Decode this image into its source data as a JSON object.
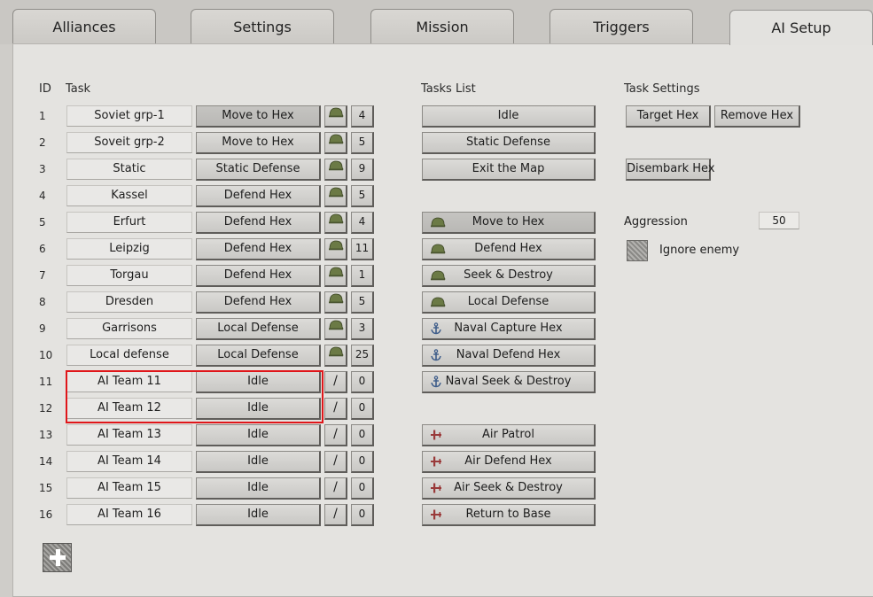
{
  "tabs": [
    {
      "label": "Alliances"
    },
    {
      "label": "Settings"
    },
    {
      "label": "Mission"
    },
    {
      "label": "Triggers"
    },
    {
      "label": "AI Setup",
      "active": true
    }
  ],
  "headers": {
    "id": "ID",
    "task": "Task",
    "tasks_list": "Tasks List",
    "task_settings": "Task Settings"
  },
  "teams": [
    {
      "id": "1",
      "name": "Soviet grp-1",
      "task": "Move to Hex",
      "icon": "helmet-icon",
      "count": "4",
      "pressed": true
    },
    {
      "id": "2",
      "name": "Soveit grp-2",
      "task": "Move to Hex",
      "icon": "helmet-icon",
      "count": "5"
    },
    {
      "id": "3",
      "name": "Static",
      "task": "Static Defense",
      "icon": "helmet-icon",
      "count": "9"
    },
    {
      "id": "4",
      "name": "Kassel",
      "task": "Defend Hex",
      "icon": "helmet-icon",
      "count": "5"
    },
    {
      "id": "5",
      "name": "Erfurt",
      "task": "Defend Hex",
      "icon": "helmet-icon",
      "count": "4"
    },
    {
      "id": "6",
      "name": "Leipzig",
      "task": "Defend Hex",
      "icon": "helmet-icon",
      "count": "11"
    },
    {
      "id": "7",
      "name": "Torgau",
      "task": "Defend Hex",
      "icon": "helmet-icon",
      "count": "1"
    },
    {
      "id": "8",
      "name": "Dresden",
      "task": "Defend Hex",
      "icon": "helmet-icon",
      "count": "5"
    },
    {
      "id": "9",
      "name": "Garrisons",
      "task": "Local Defense",
      "icon": "helmet-icon",
      "count": "3"
    },
    {
      "id": "10",
      "name": "Local defense",
      "task": "Local Defense",
      "icon": "helmet-icon",
      "count": "25"
    },
    {
      "id": "11",
      "name": "AI Team 11",
      "task": "Idle",
      "icon": "slash-icon",
      "count": "0"
    },
    {
      "id": "12",
      "name": "AI Team 12",
      "task": "Idle",
      "icon": "slash-icon",
      "count": "0"
    },
    {
      "id": "13",
      "name": "AI Team 13",
      "task": "Idle",
      "icon": "slash-icon",
      "count": "0"
    },
    {
      "id": "14",
      "name": "AI Team 14",
      "task": "Idle",
      "icon": "slash-icon",
      "count": "0"
    },
    {
      "id": "15",
      "name": "AI Team 15",
      "task": "Idle",
      "icon": "slash-icon",
      "count": "0"
    },
    {
      "id": "16",
      "name": "AI Team 16",
      "task": "Idle",
      "icon": "slash-icon",
      "count": "0"
    }
  ],
  "tasks_list": [
    {
      "label": "Idle",
      "icon": "",
      "row": 0
    },
    {
      "label": "Static Defense",
      "icon": "",
      "row": 1
    },
    {
      "label": "Exit the Map",
      "icon": "",
      "row": 2
    },
    {
      "label": "Move to Hex",
      "icon": "helmet-icon",
      "row": 4,
      "pressed": true
    },
    {
      "label": "Defend Hex",
      "icon": "helmet-icon",
      "row": 5
    },
    {
      "label": "Seek & Destroy",
      "icon": "helmet-icon",
      "row": 6
    },
    {
      "label": "Local Defense",
      "icon": "helmet-icon",
      "row": 7
    },
    {
      "label": "Naval Capture Hex",
      "icon": "anchor-icon",
      "row": 8
    },
    {
      "label": "Naval Defend Hex",
      "icon": "anchor-icon",
      "row": 9
    },
    {
      "label": "Naval Seek & Destroy",
      "icon": "anchor-icon",
      "row": 10
    },
    {
      "label": "Air Patrol",
      "icon": "plane-icon",
      "row": 12
    },
    {
      "label": "Air Defend Hex",
      "icon": "plane-icon",
      "row": 13
    },
    {
      "label": "Air Seek & Destroy",
      "icon": "plane-icon",
      "row": 14
    },
    {
      "label": "Return to Base",
      "icon": "plane-icon",
      "row": 15
    }
  ],
  "task_settings": {
    "target_hex": "Target Hex",
    "remove_hex": "Remove Hex",
    "disembark_hex": "Disembark Hex",
    "aggression_label": "Aggression",
    "aggression_value": "50",
    "ignore_enemy_label": "Ignore enemy",
    "ignore_enemy_checked": false
  },
  "selection": {
    "team_ids": [
      "11",
      "12"
    ],
    "color": "#e0161a"
  },
  "colors": {
    "helmet": "#6b7a45",
    "anchor": "#3e5d8a",
    "plane": "#9a3a3a",
    "selection": "#e0161a"
  }
}
